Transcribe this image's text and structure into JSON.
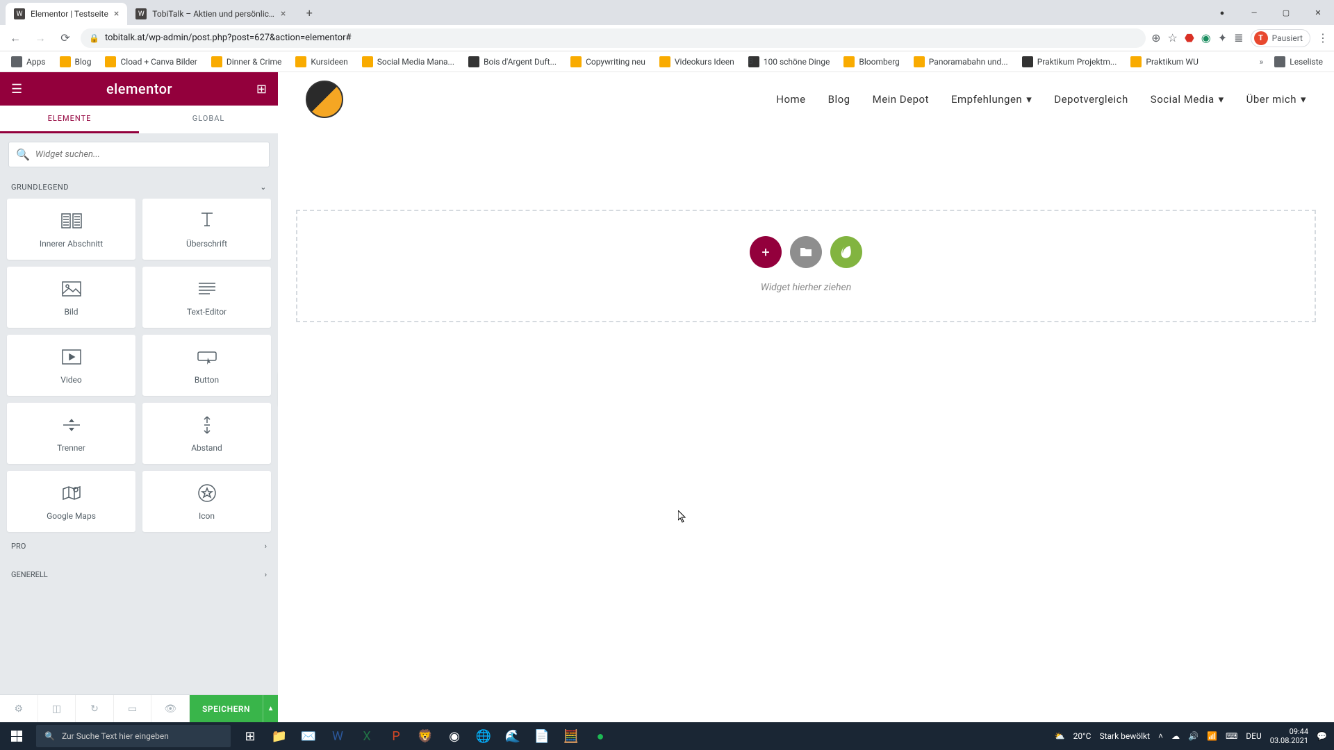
{
  "browser": {
    "tabs": [
      {
        "title": "Elementor | Testseite"
      },
      {
        "title": "TobiTalk – Aktien und persönlich..."
      }
    ],
    "url": "tobitalk.at/wp-admin/post.php?post=627&action=elementor#",
    "profile_label": "Pausiert",
    "profile_initial": "T",
    "bookmarks": {
      "apps": "Apps",
      "items": [
        "Blog",
        "Cload + Canva Bilder",
        "Dinner & Crime",
        "Kursideen",
        "Social Media Mana...",
        "Bois d'Argent Duft...",
        "Copywriting neu",
        "Videokurs Ideen",
        "100 schöne Dinge",
        "Bloomberg",
        "Panoramabahn und...",
        "Praktikum Projektm...",
        "Praktikum WU"
      ],
      "readlist": "Leseliste"
    }
  },
  "panel": {
    "brand": "elementor",
    "tabs": {
      "elements": "ELEMENTE",
      "global": "GLOBAL"
    },
    "search_placeholder": "Widget suchen...",
    "categories": {
      "basic": "GRUNDLEGEND",
      "pro": "PRO",
      "general": "GENERELL"
    },
    "widgets": {
      "inner_section": "Innerer Abschnitt",
      "heading": "Überschrift",
      "image": "Bild",
      "text_editor": "Text-Editor",
      "video": "Video",
      "button": "Button",
      "divider": "Trenner",
      "spacer": "Abstand",
      "maps": "Google Maps",
      "icon": "Icon"
    },
    "footer": {
      "save": "SPEICHERN"
    }
  },
  "site": {
    "nav": {
      "home": "Home",
      "blog": "Blog",
      "depot": "Mein Depot",
      "recs": "Empfehlungen",
      "compare": "Depotvergleich",
      "social": "Social Media",
      "about": "Über mich"
    },
    "dropzone_text": "Widget hierher ziehen"
  },
  "taskbar": {
    "search_placeholder": "Zur Suche Text hier eingeben",
    "weather_temp": "20°C",
    "weather_label": "Stark bewölkt",
    "lang": "DEU",
    "time": "09:44",
    "date": "03.08.2021"
  }
}
